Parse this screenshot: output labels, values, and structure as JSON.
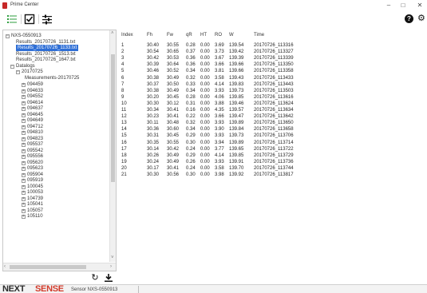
{
  "window": {
    "title": "Prime Center",
    "minimize": "–",
    "maximize": "□",
    "close": "✕"
  },
  "toolbar": {
    "list_icon": "list-icon",
    "check_icon": "checkbox-icon",
    "sliders_icon": "sliders-icon",
    "help_label": "?",
    "settings_icon": "gear-icon"
  },
  "tree": {
    "root": "NXS-0550913",
    "files": [
      "Results_20170726_1131.txt",
      "Results_20170726_1133.txt",
      "Results_20170726_1513.txt",
      "Results_20170726_1647.txt"
    ],
    "selected_file_index": 1,
    "datalogs_label": "Datalogs",
    "date_folder": "20170725",
    "measurements": "Measurements-20170725",
    "items": [
      "094459",
      "094633",
      "094552",
      "094614",
      "094637",
      "094645",
      "094649",
      "094712",
      "094810",
      "094823",
      "095537",
      "095542",
      "095556",
      "095620",
      "095623",
      "095904",
      "095919",
      "100045",
      "100053",
      "104739",
      "105041",
      "105057",
      "105110"
    ]
  },
  "table": {
    "columns": [
      "Index",
      "Fh",
      "Fw",
      "qR",
      "HT",
      "RO",
      "W",
      "Time"
    ],
    "rows": [
      [
        "1",
        "30.40",
        "30.55",
        "0.28",
        "0.00",
        "3.69",
        "139.54",
        "20170726_113316"
      ],
      [
        "2",
        "30.54",
        "30.65",
        "0.37",
        "0.00",
        "3.73",
        "139.42",
        "20170726_113327"
      ],
      [
        "3",
        "30.42",
        "30.53",
        "0.36",
        "0.00",
        "3.67",
        "139.39",
        "20170726_113339"
      ],
      [
        "4",
        "30.39",
        "30.64",
        "0.36",
        "0.00",
        "3.66",
        "139.66",
        "20170726_113350"
      ],
      [
        "5",
        "30.46",
        "30.52",
        "0.34",
        "0.00",
        "3.81",
        "139.66",
        "20170726_113358"
      ],
      [
        "6",
        "30.38",
        "30.49",
        "0.32",
        "0.00",
        "3.58",
        "139.43",
        "20170726_113433"
      ],
      [
        "7",
        "30.37",
        "30.50",
        "0.33",
        "0.00",
        "4.14",
        "139.83",
        "20170726_113443"
      ],
      [
        "8",
        "30.38",
        "30.49",
        "0.34",
        "0.00",
        "3.93",
        "139.73",
        "20170726_113503"
      ],
      [
        "9",
        "30.20",
        "30.45",
        "0.28",
        "0.00",
        "4.06",
        "139.85",
        "20170726_113616"
      ],
      [
        "10",
        "30.30",
        "30.12",
        "0.31",
        "0.00",
        "3.88",
        "139.46",
        "20170726_113624"
      ],
      [
        "11",
        "30.34",
        "30.41",
        "0.16",
        "0.00",
        "4.35",
        "139.57",
        "20170726_113634"
      ],
      [
        "12",
        "30.23",
        "30.41",
        "0.22",
        "0.00",
        "3.66",
        "139.47",
        "20170726_113642"
      ],
      [
        "13",
        "30.11",
        "30.48",
        "0.32",
        "0.00",
        "3.93",
        "139.89",
        "20170726_113650"
      ],
      [
        "14",
        "30.36",
        "30.60",
        "0.34",
        "0.00",
        "3.90",
        "139.84",
        "20170726_113658"
      ],
      [
        "15",
        "30.31",
        "30.45",
        "0.29",
        "0.00",
        "3.93",
        "139.73",
        "20170726_113706"
      ],
      [
        "16",
        "30.35",
        "30.55",
        "0.30",
        "0.00",
        "3.94",
        "139.89",
        "20170726_113714"
      ],
      [
        "17",
        "30.14",
        "30.42",
        "0.24",
        "0.00",
        "3.77",
        "139.65",
        "20170726_113722"
      ],
      [
        "18",
        "30.26",
        "30.49",
        "0.29",
        "0.00",
        "4.14",
        "139.85",
        "20170726_113729"
      ],
      [
        "19",
        "30.24",
        "30.49",
        "0.26",
        "0.00",
        "3.93",
        "139.91",
        "20170726_113736"
      ],
      [
        "20",
        "30.17",
        "30.41",
        "0.24",
        "0.00",
        "3.58",
        "139.70",
        "20170726_113744"
      ],
      [
        "21",
        "30.30",
        "30.56",
        "0.30",
        "0.00",
        "3.98",
        "139.92",
        "20170726_113817"
      ]
    ]
  },
  "footer": {
    "refresh_icon": "refresh-icon",
    "download_icon": "download-icon"
  },
  "status": {
    "brand_next": "NEXT",
    "brand_sense": "SENSE",
    "sensor": "Sensor NXS-0550913"
  },
  "colors": {
    "selection": "#2f6fd6",
    "brand_red": "#d23a2a",
    "toolbar_green": "#2e9e3e"
  }
}
